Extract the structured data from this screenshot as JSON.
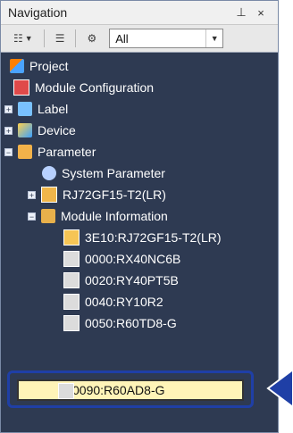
{
  "panel": {
    "title": "Navigation",
    "pin_icon": "pin-icon",
    "close_icon": "close-icon"
  },
  "toolbar": {
    "button1_icon": "tree-view-icon",
    "button2_icon": "tree-collapse-icon",
    "settings_icon": "gear-icon",
    "filter_value": "All",
    "filter_arrow_icon": "chevron-down-icon"
  },
  "tree": {
    "items": [
      {
        "label": "Project",
        "icon": "project-icon",
        "expander": ""
      },
      {
        "label": "Module Configuration",
        "icon": "module-configuration-icon",
        "expander": ""
      },
      {
        "label": "Label",
        "icon": "label-icon",
        "expander": "+"
      },
      {
        "label": "Device",
        "icon": "device-icon",
        "expander": "+"
      },
      {
        "label": "Parameter",
        "icon": "parameter-icon",
        "expander": "−"
      },
      {
        "label": "System Parameter",
        "icon": "system-parameter-icon",
        "expander": ""
      },
      {
        "label": "RJ72GF15-T2(LR)",
        "icon": "cpu-module-icon",
        "expander": "+"
      },
      {
        "label": "Module Information",
        "icon": "module-information-icon",
        "expander": "−"
      },
      {
        "label": "3E10:RJ72GF15-T2(LR)",
        "icon": "module-icon",
        "expander": ""
      },
      {
        "label": "0000:RX40NC6B",
        "icon": "module-icon",
        "expander": ""
      },
      {
        "label": "0020:RY40PT5B",
        "icon": "module-icon",
        "expander": ""
      },
      {
        "label": "0040:RY10R2",
        "icon": "module-icon",
        "expander": ""
      },
      {
        "label": "0050:R60TD8-G",
        "icon": "module-icon",
        "expander": ""
      }
    ],
    "selected_item": {
      "label": "0090:R60AD8-G",
      "icon": "module-icon"
    }
  },
  "colors": {
    "panel_bg": "#2e3a52",
    "highlight_border": "#1f3fa6",
    "selected_bg": "#fff4b8"
  }
}
